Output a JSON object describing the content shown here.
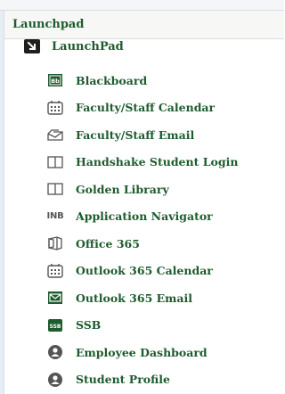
{
  "panel": {
    "title": "Launchpad"
  },
  "root": {
    "label": "LaunchPad",
    "icon": "arrow-box-icon"
  },
  "items": [
    {
      "label": "Blackboard",
      "icon": "blackboard-icon"
    },
    {
      "label": "Faculty/Staff Calendar",
      "icon": "calendar-icon"
    },
    {
      "label": "Faculty/Staff Email",
      "icon": "envelope-open-icon"
    },
    {
      "label": "Handshake Student Login",
      "icon": "book-icon"
    },
    {
      "label": "Golden Library",
      "icon": "book-icon"
    },
    {
      "label": "Application Navigator",
      "icon": "inb-icon",
      "icon_text": "INB"
    },
    {
      "label": "Office 365",
      "icon": "office-icon"
    },
    {
      "label": "Outlook 365 Calendar",
      "icon": "calendar-icon"
    },
    {
      "label": "Outlook 365 Email",
      "icon": "email-box-icon"
    },
    {
      "label": "SSB",
      "icon": "ssb-icon",
      "icon_text": "SSB"
    },
    {
      "label": "Employee Dashboard",
      "icon": "user-circle-icon"
    },
    {
      "label": "Student Profile",
      "icon": "user-circle-icon"
    }
  ],
  "colors": {
    "brand_green": "#1e5b2e",
    "header_bg": "#f7f8f5",
    "icon_gray": "#555555"
  }
}
